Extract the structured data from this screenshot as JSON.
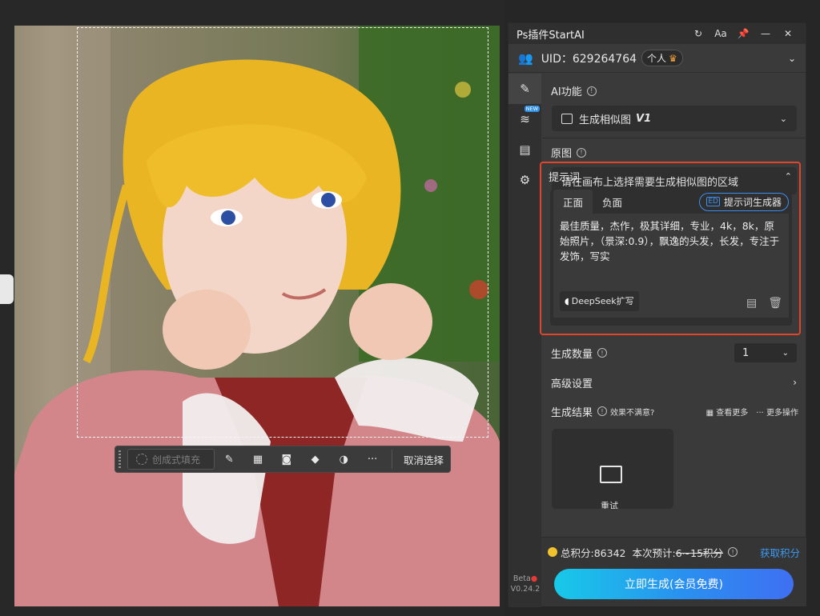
{
  "canvas": {
    "toolbar": {
      "generative_fill": "创成式填充",
      "cancel_selection": "取消选择"
    }
  },
  "panel": {
    "title": "Ps插件StartAI",
    "title_buttons": [
      "↻",
      "Aa",
      "📌",
      "—",
      "✕"
    ],
    "uid_text": "UID：629264764",
    "badge": "个人",
    "badge_icon": "crown",
    "rail_new_badge": "NEW",
    "version_beta": "Beta",
    "version": "V0.24.2",
    "ai_function": {
      "label": "AI功能",
      "selected": "生成相似图",
      "version_tag": "V1"
    },
    "original": {
      "label": "原图",
      "hint": "请在画布上选择需要生成相似图的区域"
    },
    "prompt": {
      "label": "提示词",
      "tab_positive": "正面",
      "tab_negative": "负面",
      "generator_button": "提示词生成器",
      "text": "最佳质量，杰作，极其详细，专业，4k，8k，原始照片，（景深:0.9），飘逸的头发，长发，专注于发饰，写实",
      "deepseek_button": "DeepSeek扩写"
    },
    "count": {
      "label": "生成数量",
      "value": "1"
    },
    "advanced": {
      "label": "高级设置"
    },
    "results": {
      "label": "生成结果",
      "unsatisfied": "效果不满意?",
      "view_more": "查看更多",
      "more_actions": "··· 更多操作",
      "retry": "重试"
    },
    "footer": {
      "total_points": "总积分:86342",
      "estimate_label": "本次预计:",
      "estimate_value": "6~15积分",
      "get_points": "获取积分",
      "generate_button": "立即生成(会员免费)"
    }
  }
}
